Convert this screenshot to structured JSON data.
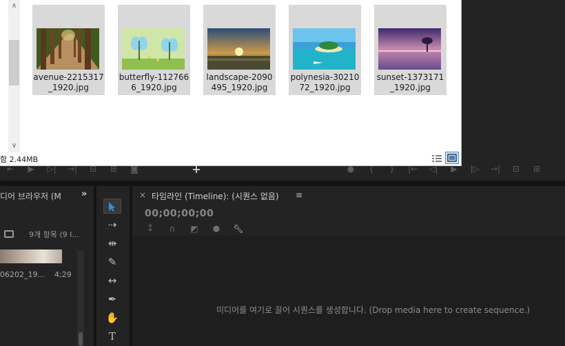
{
  "explorer": {
    "files": [
      {
        "name_line1": "avenue-2215317",
        "name_line2": "_1920.jpg",
        "thumb": "forest-avenue"
      },
      {
        "name_line1": "butterfly-112766",
        "name_line2": "6_1920.jpg",
        "thumb": "butterflies"
      },
      {
        "name_line1": "landscape-2090",
        "name_line2": "495_1920.jpg",
        "thumb": "sunrise-landscape"
      },
      {
        "name_line1": "polynesia-30210",
        "name_line2": "72_1920.jpg",
        "thumb": "tropical-island"
      },
      {
        "name_line1": "sunset-1373171",
        "name_line2": "_1920.jpg",
        "thumb": "purple-sunset"
      }
    ],
    "status_text": "함 2.44MB",
    "icons": {
      "details_view": "details-view-icon",
      "large_icons_view": "large-icons-view-icon"
    }
  },
  "media_browser": {
    "title": "디어 브라우저 (M",
    "more": "»",
    "item_count": "9개 항목 (9 I...",
    "clip_name": "06202_19...",
    "clip_duration": "4;29"
  },
  "tools": [
    "selection",
    "track-select",
    "ripple-edit",
    "razor",
    "slip",
    "pen",
    "hand",
    "type"
  ],
  "timeline": {
    "close": "×",
    "title": "타임라인 (Timeline): (시퀀스 없음)",
    "menu": "≡",
    "timecode": "00;00;00;00",
    "drop_hint": "미디어를 여기로 끌어 시퀀스를 생성합니다. (Drop media here to create sequence.)"
  },
  "colors": {
    "accent_blue": "#2f8de4",
    "panel_bg": "#232323",
    "explorer_tile": "#d9d9d9"
  }
}
